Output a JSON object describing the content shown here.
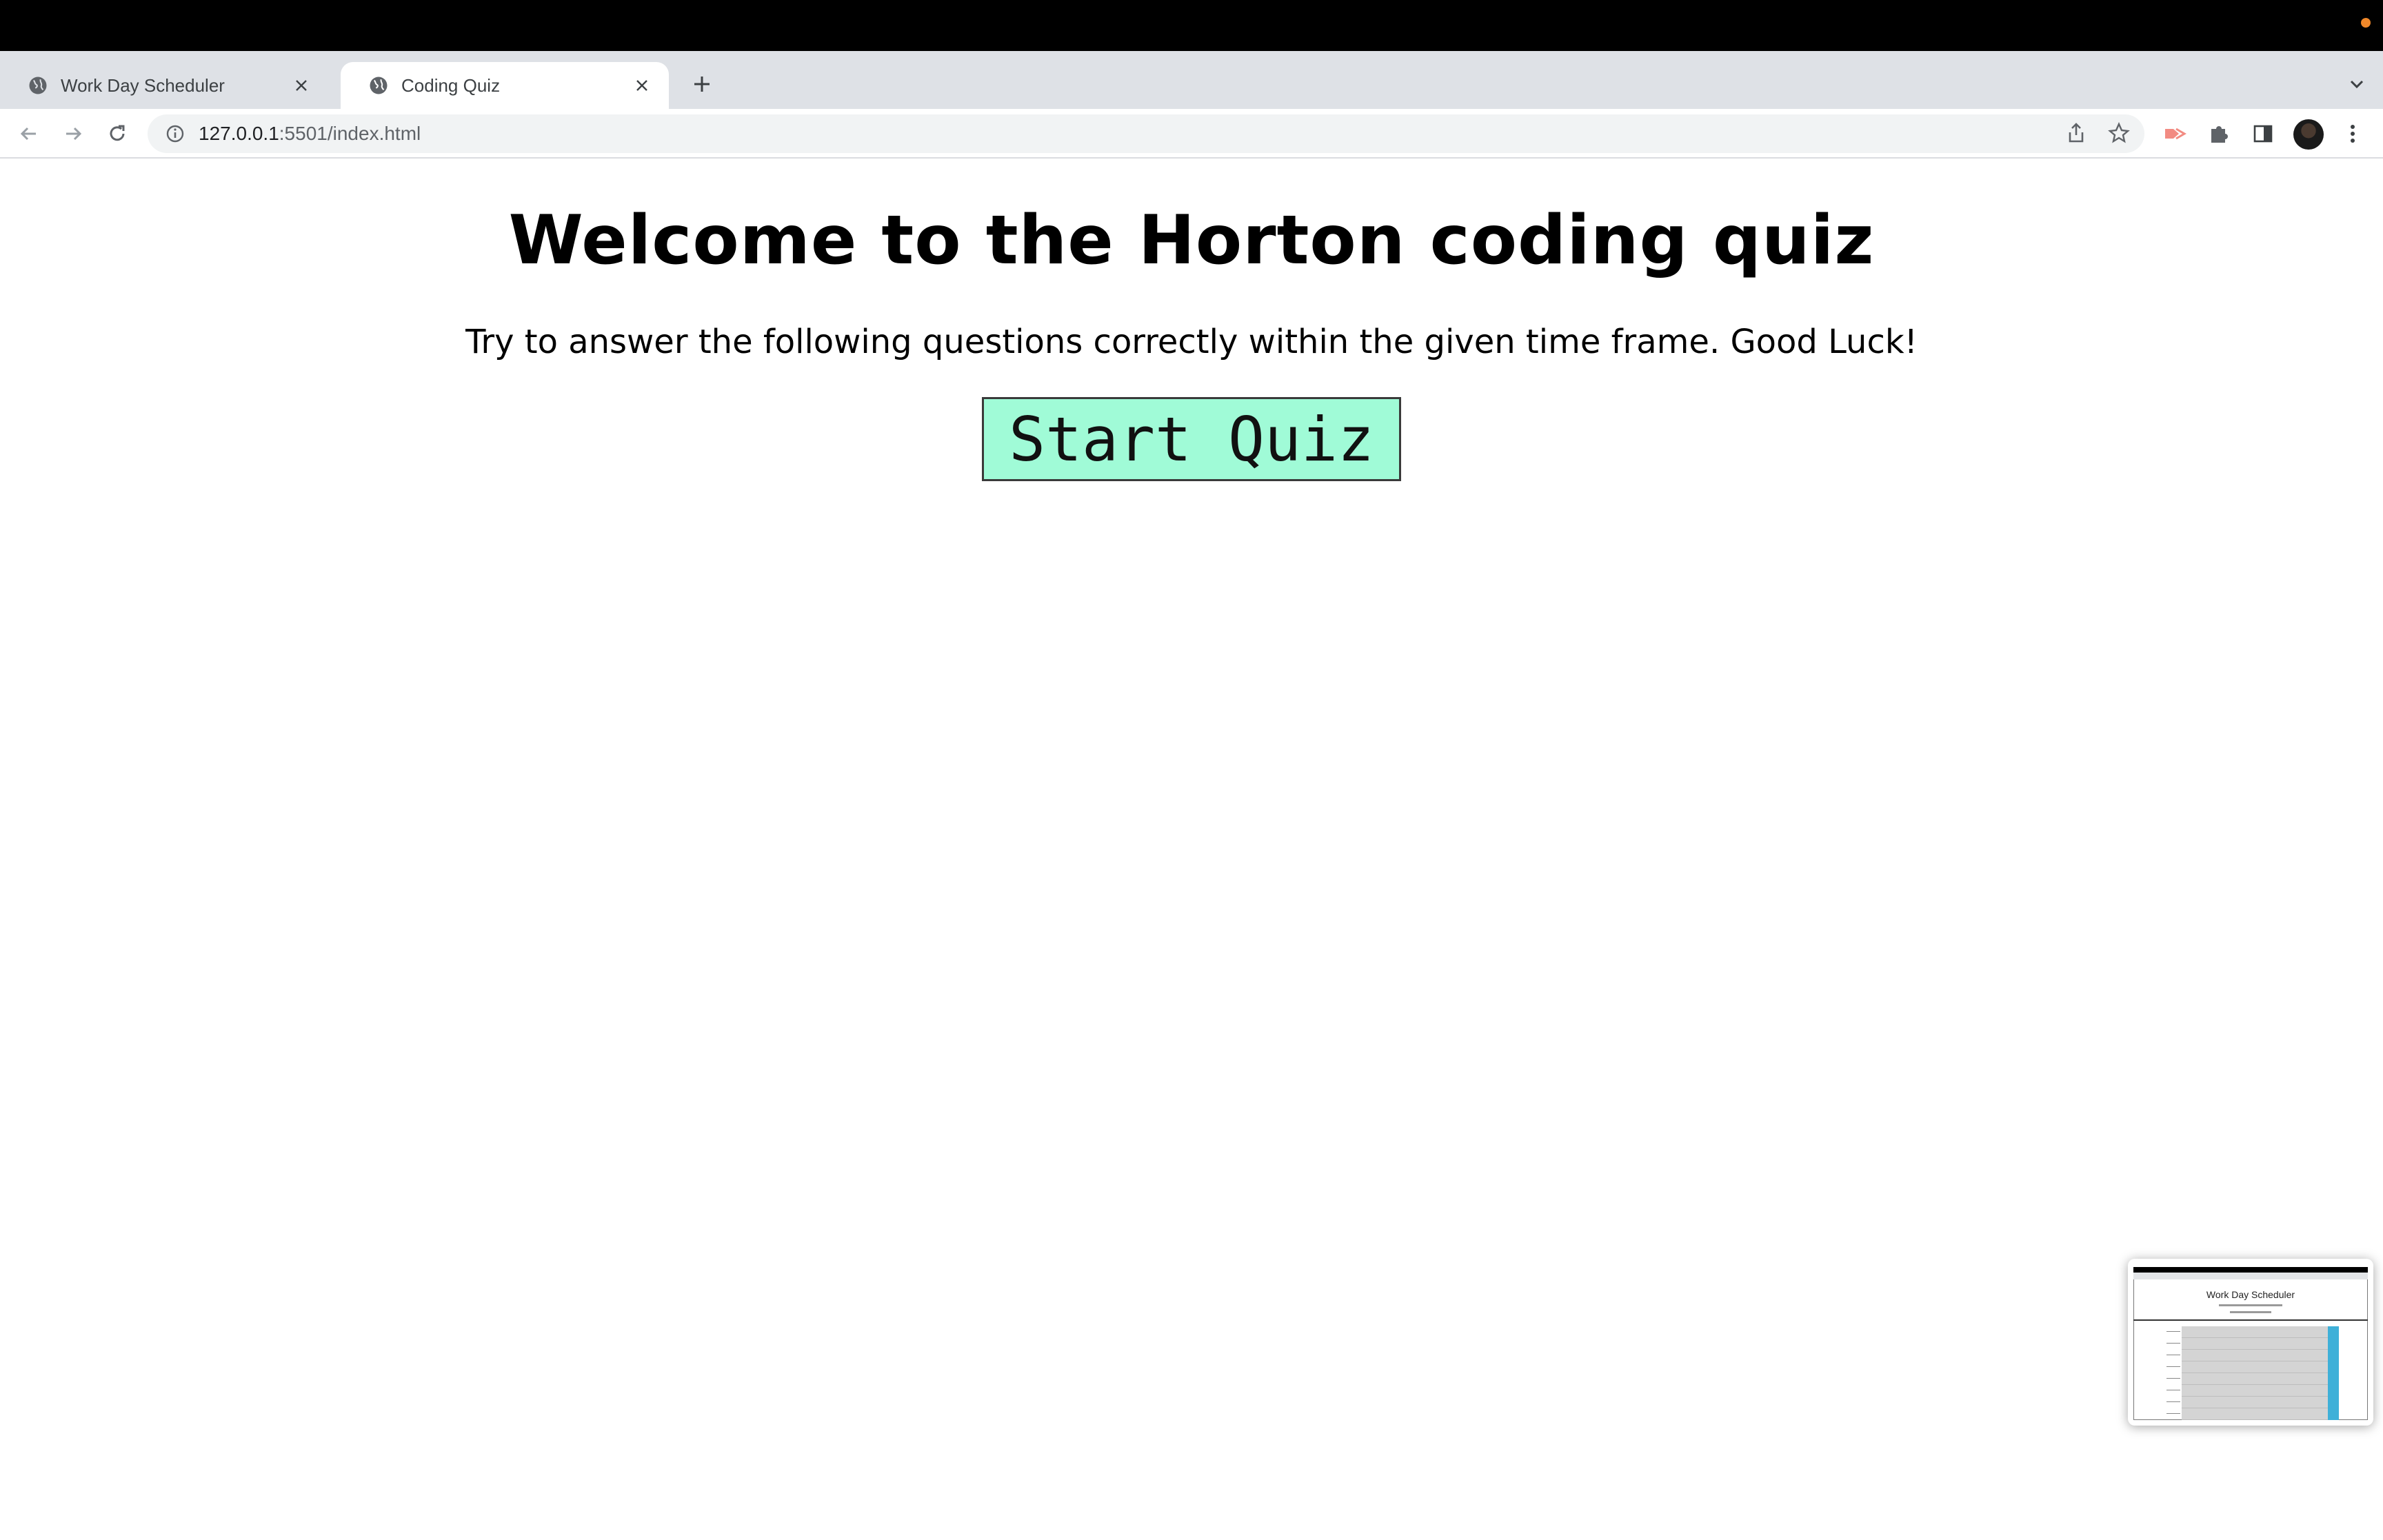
{
  "browser": {
    "tabs": [
      {
        "title": "Work Day Scheduler",
        "active": false,
        "icon": "globe-icon"
      },
      {
        "title": "Coding Quiz",
        "active": true,
        "icon": "globe-icon"
      }
    ],
    "url": {
      "host": "127.0.0.1",
      "rest": ":5501/index.html"
    }
  },
  "page": {
    "title": "Welcome to the Horton coding quiz",
    "subtitle": "Try to answer the following questions correctly within the given time frame. Good Luck!",
    "start_button": "Start Quiz"
  },
  "thumbnail": {
    "title": "Work Day Scheduler"
  },
  "colors": {
    "start_button_bg": "#a0fbd7",
    "tab_strip": "#dee1e6",
    "accent_dot": "#f0882a"
  }
}
